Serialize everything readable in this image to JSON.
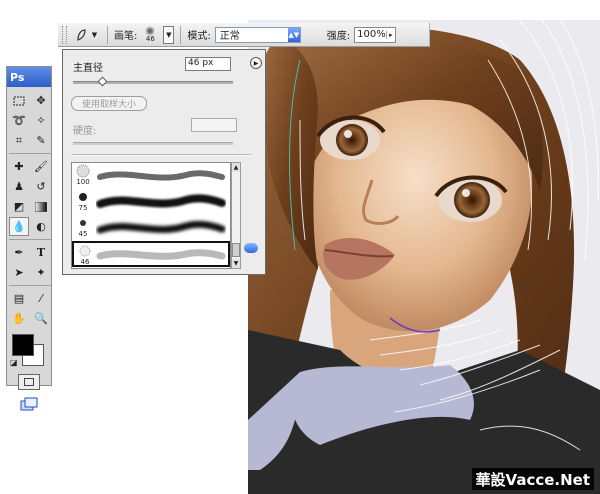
{
  "options_bar": {
    "brush_label": "画笔:",
    "brush_size": "46",
    "mode_label": "模式:",
    "mode_value": "正常",
    "strength_label": "强度:",
    "strength_value": "100%"
  },
  "brush_panel": {
    "master_diameter_label": "主直径",
    "master_diameter_value": "46 px",
    "master_diameter_slider_fraction": 0.18,
    "use_sample_size_label": "使用取样大小",
    "hardness_label": "硬度:",
    "hardness_value": "",
    "presets": [
      {
        "size": "100",
        "style": "chalk"
      },
      {
        "size": "75",
        "style": "soft"
      },
      {
        "size": "45",
        "style": "soft"
      },
      {
        "size": "46",
        "style": "spatter",
        "selected": true
      }
    ]
  },
  "toolbox": {
    "title": "Ps",
    "tools": [
      "marquee-tool",
      "move-tool",
      "lasso-tool",
      "magic-wand-tool",
      "crop-tool",
      "slice-tool",
      "healing-brush-tool",
      "brush-tool",
      "clone-stamp-tool",
      "history-brush-tool",
      "eraser-tool",
      "gradient-tool",
      "blur-tool",
      "dodge-tool",
      "pen-tool",
      "type-tool",
      "path-selection-tool",
      "shape-tool",
      "notes-tool",
      "eyedropper-tool",
      "hand-tool",
      "zoom-tool"
    ],
    "foreground_color": "#000000",
    "background_color": "#ffffff",
    "active_tool": "blur-tool"
  },
  "watermark": {
    "text": "華設Vacce.Net"
  },
  "colors": {
    "hair": "#7a4a22",
    "skin": "#e2b48d",
    "collar": "#b6b8d4",
    "shirt": "#2a2a2a",
    "toolbox_header": "#2d5dc9"
  }
}
